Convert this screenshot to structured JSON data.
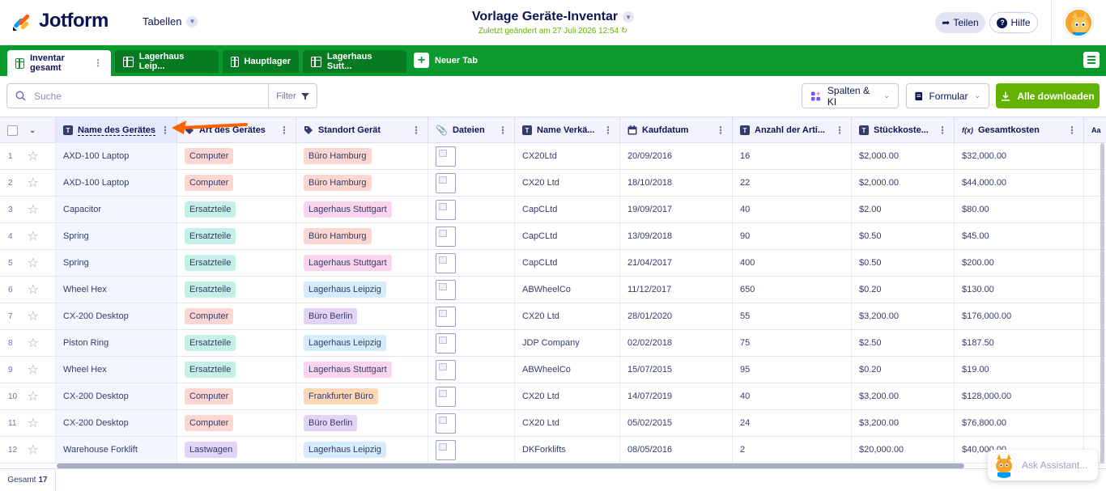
{
  "header": {
    "brand": "Jotform",
    "tables_label": "Tabellen",
    "doc_title": "Vorlage Geräte-Inventar",
    "last_changed": "Zuletzt geändert am 27 Juli 2026 12:54",
    "share_label": "Teilen",
    "help_label": "Hilfe"
  },
  "tabs": [
    {
      "label": "Inventar gesamt"
    },
    {
      "label": "Lagerhaus Leip..."
    },
    {
      "label": "Hauptlager"
    },
    {
      "label": "Lagerhaus Sutt..."
    }
  ],
  "new_tab_label": "Neuer Tab",
  "toolbar": {
    "search_placeholder": "Suche",
    "filter_label": "Filter",
    "columns_ai_label": "Spalten & KI",
    "form_label": "Formular",
    "download_label": "Alle downloaden"
  },
  "columns": [
    {
      "label": "Name des Gerätes",
      "icon": "T"
    },
    {
      "label": "Art des Gerätes",
      "icon": "tag"
    },
    {
      "label": "Standort Gerät",
      "icon": "tag"
    },
    {
      "label": "Dateien",
      "icon": "clip"
    },
    {
      "label": "Name Verkä...",
      "icon": "T"
    },
    {
      "label": "Kaufdatum",
      "icon": "calendar"
    },
    {
      "label": "Anzahl der Arti...",
      "icon": "T"
    },
    {
      "label": "Stückkoste...",
      "icon": "T"
    },
    {
      "label": "Gesamtkosten",
      "icon": "f(x)"
    },
    {
      "label": "",
      "icon": "Aa"
    }
  ],
  "rows": [
    {
      "n": "1",
      "name": "AXD-100 Laptop",
      "type": "Computer",
      "loc": "Büro Hamburg",
      "vendor": "CX20Ltd",
      "date": "20/09/2016",
      "qty": "16",
      "unit": "$2,000.00",
      "total": "$32,000.00"
    },
    {
      "n": "2",
      "name": "AXD-100 Laptop",
      "type": "Computer",
      "loc": "Büro Hamburg",
      "vendor": "CX20 Ltd",
      "date": "18/10/2018",
      "qty": "22",
      "unit": "$2,000.00",
      "total": "$44,000.00"
    },
    {
      "n": "3",
      "name": "Capacitor",
      "type": "Ersatzteile",
      "loc": "Lagerhaus Stuttgart",
      "vendor": "CapCLtd",
      "date": "19/09/2017",
      "qty": "40",
      "unit": "$2.00",
      "total": "$80.00"
    },
    {
      "n": "4",
      "name": "Spring",
      "type": "Ersatzteile",
      "loc": "Büro Hamburg",
      "vendor": "CapCLtd",
      "date": "13/09/2018",
      "qty": "90",
      "unit": "$0.50",
      "total": "$45.00"
    },
    {
      "n": "5",
      "name": "Spring",
      "type": "Ersatzteile",
      "loc": "Lagerhaus Stuttgart",
      "vendor": "CapCLtd",
      "date": "21/04/2017",
      "qty": "400",
      "unit": "$0.50",
      "total": "$200.00"
    },
    {
      "n": "6",
      "name": "Wheel Hex",
      "type": "Ersatzteile",
      "loc": "Lagerhaus Leipzig",
      "vendor": "ABWheelCo",
      "date": "11/12/2017",
      "qty": "650",
      "unit": "$0.20",
      "total": "$130.00"
    },
    {
      "n": "7",
      "name": "CX-200 Desktop",
      "type": "Computer",
      "loc": "Büro Berlin",
      "vendor": "CX20 Ltd",
      "date": "28/01/2020",
      "qty": "55",
      "unit": "$3,200.00",
      "total": "$176,000.00"
    },
    {
      "n": "8",
      "name": "Piston Ring",
      "type": "Ersatzteile",
      "loc": "Lagerhaus Leipzig",
      "vendor": "JDP Company",
      "date": "02/02/2018",
      "qty": "75",
      "unit": "$2.50",
      "total": "$187.50"
    },
    {
      "n": "9",
      "name": "Wheel Hex",
      "type": "Ersatzteile",
      "loc": "Lagerhaus Stuttgart",
      "vendor": "ABWheelCo",
      "date": "15/07/2015",
      "qty": "95",
      "unit": "$0.20",
      "total": "$19.00"
    },
    {
      "n": "10",
      "name": "CX-200 Desktop",
      "type": "Computer",
      "loc": "Frankfurter Büro",
      "vendor": "CX20 Ltd",
      "date": "14/07/2019",
      "qty": "40",
      "unit": "$3,200.00",
      "total": "$128,000.00"
    },
    {
      "n": "11",
      "name": "CX-200 Desktop",
      "type": "Computer",
      "loc": "Büro Berlin",
      "vendor": "CX20 Ltd",
      "date": "05/02/2015",
      "qty": "24",
      "unit": "$3,200.00",
      "total": "$76,800.00"
    },
    {
      "n": "12",
      "name": "Warehouse Forklift",
      "type": "Lastwagen",
      "loc": "Lagerhaus Leipzig",
      "vendor": "DKForklifts",
      "date": "08/05/2016",
      "qty": "2",
      "unit": "$20,000.00",
      "total": "$40,000.00"
    }
  ],
  "tag_colors": {
    "Computer": "#fcd6d0",
    "Ersatzteile": "#c5f0e6",
    "Lastwagen": "#e2d4f7",
    "Büro Hamburg": "#fcd6d0",
    "Lagerhaus Stuttgart": "#fbd4ee",
    "Lagerhaus Leipzig": "#d4ecfb",
    "Büro Berlin": "#e2d4f7",
    "Frankfurter Büro": "#fdd7b6"
  },
  "footer": {
    "total_label": "Gesamt",
    "total_count": "17"
  },
  "assistant_label": "Ask Assistant...",
  "accent": {
    "brand_green": "#0c9a2e",
    "download_green": "#64b200",
    "annotation_arrow": "#ff6100"
  }
}
